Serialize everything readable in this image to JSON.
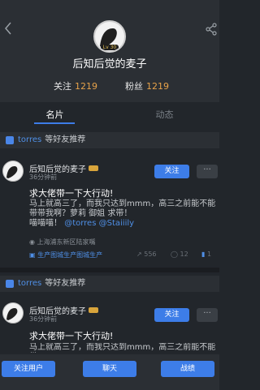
{
  "header": {
    "back_icon": "chevron-left-icon",
    "share_icon": "share-icon",
    "avatar_badge": "Lv 30",
    "username": "后知后觉的麦子",
    "following_label": "关注",
    "following_count": "1219",
    "followers_label": "粉丝",
    "followers_count": "1219"
  },
  "tabs": [
    {
      "label": "名片",
      "active": true
    },
    {
      "label": "动态",
      "active": false
    }
  ],
  "posts": [
    {
      "rec_user": "torres",
      "rec_text": "等好友推荐",
      "author": "后知后觉的麦子",
      "time": "36分钟前",
      "follow_label": "关注",
      "more_label": "···",
      "title": "求大佬带一下大行动!",
      "body": "马上就高三了，而我只达到mmm，高三之前能不能带带我啊？萝莉 御姐 求带！",
      "body_tail": "喵喵喵！",
      "mention1": "@torres",
      "mention2": "@Staiiily",
      "location": "上海浦东新区陆家嘴",
      "group": "生产图城生产图城生产",
      "views": "556",
      "comments": "12",
      "likes": "1"
    },
    {
      "rec_user": "torres",
      "rec_text": "等好友推荐",
      "author": "后知后觉的麦子",
      "time": "36分钟前",
      "follow_label": "关注",
      "more_label": "···",
      "title": "求大佬带一下大行动!",
      "body": "马上就高三了，而我只达到mmm，高三之前能不能带"
    }
  ],
  "bottom_bar": {
    "follow_user": "关注用户",
    "chat": "聊天",
    "battle": "战绩"
  },
  "colors": {
    "accent": "#3d7de8",
    "count": "#e6a24a",
    "background": "#22262b"
  }
}
